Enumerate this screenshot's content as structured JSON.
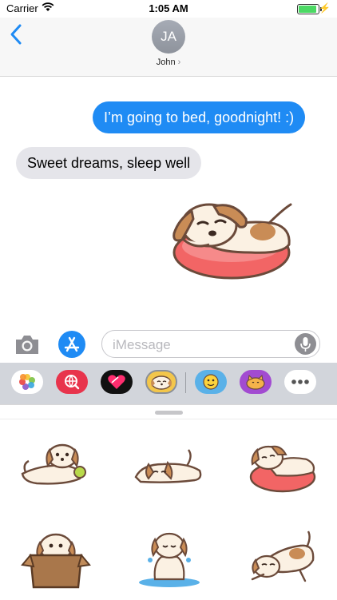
{
  "status_bar": {
    "carrier": "Carrier",
    "time": "1:05 AM",
    "battery_level": 1.0
  },
  "header": {
    "avatar_initials": "JA",
    "contact_name": "John",
    "contact_chevron": "›"
  },
  "conversation": {
    "messages": [
      {
        "direction": "outgoing",
        "text": "I’m going to bed, goodnight! :)"
      },
      {
        "direction": "incoming",
        "text": "Sweet dreams, sleep well"
      }
    ],
    "sticker_message": "puppy-sleeping-on-cushion"
  },
  "input_bar": {
    "placeholder": "iMessage"
  },
  "app_drawer": {
    "apps": [
      "photos-app",
      "web-images-app",
      "digital-touch-app",
      "puppy-sticker-app",
      "emoji-sticker-app",
      "cat-sticker-app",
      "more-apps"
    ],
    "selected": "puppy-sticker-app"
  },
  "sticker_panel": {
    "stickers": [
      "puppy-with-tennis-ball",
      "puppy-lying-down",
      "puppy-on-red-cushion",
      "puppy-in-cardboard-box",
      "puppy-crying",
      "puppy-stretching"
    ]
  },
  "colors": {
    "outgoing_bubble": "#1f8bf4",
    "incoming_bubble": "#e5e5ea",
    "accent": "#1f8bf4",
    "drawer": "#d2d5db"
  }
}
